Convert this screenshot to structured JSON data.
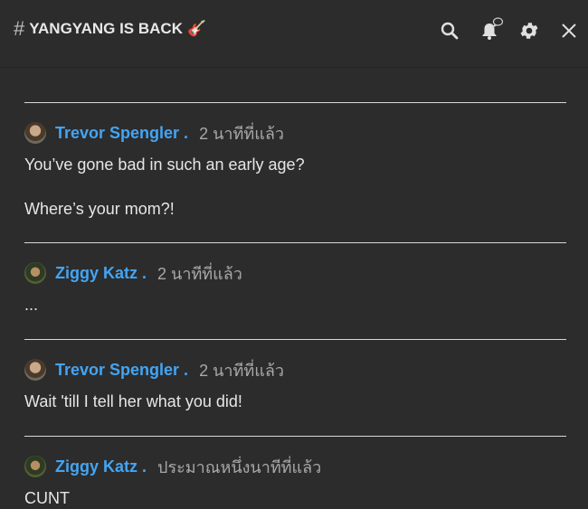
{
  "header": {
    "title": "YANGYANG IS BACK",
    "hash_symbol": "#",
    "emoji": "🎸",
    "icons": [
      "search-icon",
      "bell-icon",
      "gear-icon",
      "close-icon"
    ]
  },
  "comments": [
    {
      "author": "Trevor Spengler .",
      "time": "2 นาทีที่แล้ว",
      "lines": [
        "You’ve gone bad in such an early age?",
        "Where’s your mom?!"
      ]
    },
    {
      "author": "Ziggy Katz .",
      "time": "2 นาทีที่แล้ว",
      "lines": [
        "..."
      ]
    },
    {
      "author": "Trevor Spengler .",
      "time": "2 นาทีที่แล้ว",
      "lines": [
        "Wait 'till I tell her what you did!"
      ]
    },
    {
      "author": "Ziggy Katz .",
      "time": "ประมาณหนึ่งนาทีที่แล้ว",
      "lines": [
        "CUNT"
      ]
    }
  ],
  "colors": {
    "background": "#2c2c2c",
    "author": "#42a5f5",
    "divider": "#d8d8d8"
  }
}
